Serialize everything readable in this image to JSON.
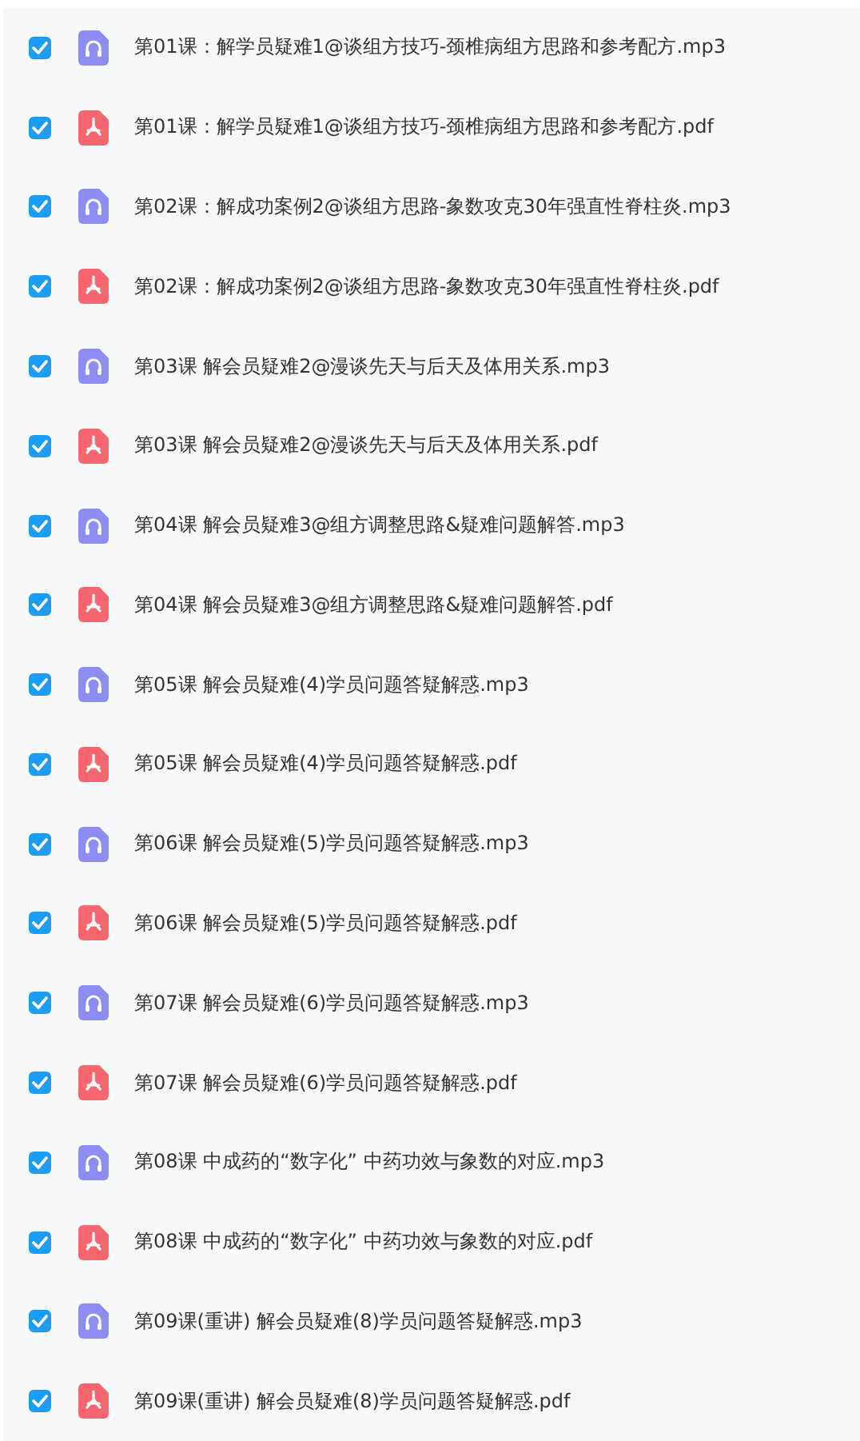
{
  "files": [
    {
      "kind": "audio",
      "checked": true,
      "name": "第01课：解学员疑难1@谈组方技巧-颈椎病组方思路和参考配方.mp3"
    },
    {
      "kind": "pdf",
      "checked": true,
      "name": "第01课：解学员疑难1@谈组方技巧-颈椎病组方思路和参考配方.pdf"
    },
    {
      "kind": "audio",
      "checked": true,
      "name": "第02课：解成功案例2@谈组方思路-象数攻克30年强直性脊柱炎.mp3"
    },
    {
      "kind": "pdf",
      "checked": true,
      "name": "第02课：解成功案例2@谈组方思路-象数攻克30年强直性脊柱炎.pdf"
    },
    {
      "kind": "audio",
      "checked": true,
      "name": "第03课 解会员疑难2@漫谈先天与后天及体用关系.mp3"
    },
    {
      "kind": "pdf",
      "checked": true,
      "name": "第03课 解会员疑难2@漫谈先天与后天及体用关系.pdf"
    },
    {
      "kind": "audio",
      "checked": true,
      "name": "第04课 解会员疑难3@组方调整思路&疑难问题解答.mp3"
    },
    {
      "kind": "pdf",
      "checked": true,
      "name": "第04课 解会员疑难3@组方调整思路&疑难问题解答.pdf"
    },
    {
      "kind": "audio",
      "checked": true,
      "name": "第05课 解会员疑难(4)学员问题答疑解惑.mp3"
    },
    {
      "kind": "pdf",
      "checked": true,
      "name": "第05课 解会员疑难(4)学员问题答疑解惑.pdf"
    },
    {
      "kind": "audio",
      "checked": true,
      "name": "第06课 解会员疑难(5)学员问题答疑解惑.mp3"
    },
    {
      "kind": "pdf",
      "checked": true,
      "name": "第06课 解会员疑难(5)学员问题答疑解惑.pdf"
    },
    {
      "kind": "audio",
      "checked": true,
      "name": "第07课 解会员疑难(6)学员问题答疑解惑.mp3"
    },
    {
      "kind": "pdf",
      "checked": true,
      "name": "第07课 解会员疑难(6)学员问题答疑解惑.pdf"
    },
    {
      "kind": "audio",
      "checked": true,
      "name": "第08课 中成药的“数字化” 中药功效与象数的对应.mp3"
    },
    {
      "kind": "pdf",
      "checked": true,
      "name": "第08课 中成药的“数字化” 中药功效与象数的对应.pdf"
    },
    {
      "kind": "audio",
      "checked": true,
      "name": "第09课(重讲) 解会员疑难(8)学员问题答疑解惑.mp3"
    },
    {
      "kind": "pdf",
      "checked": true,
      "name": "第09课(重讲) 解会员疑难(8)学员问题答疑解惑.pdf"
    }
  ]
}
